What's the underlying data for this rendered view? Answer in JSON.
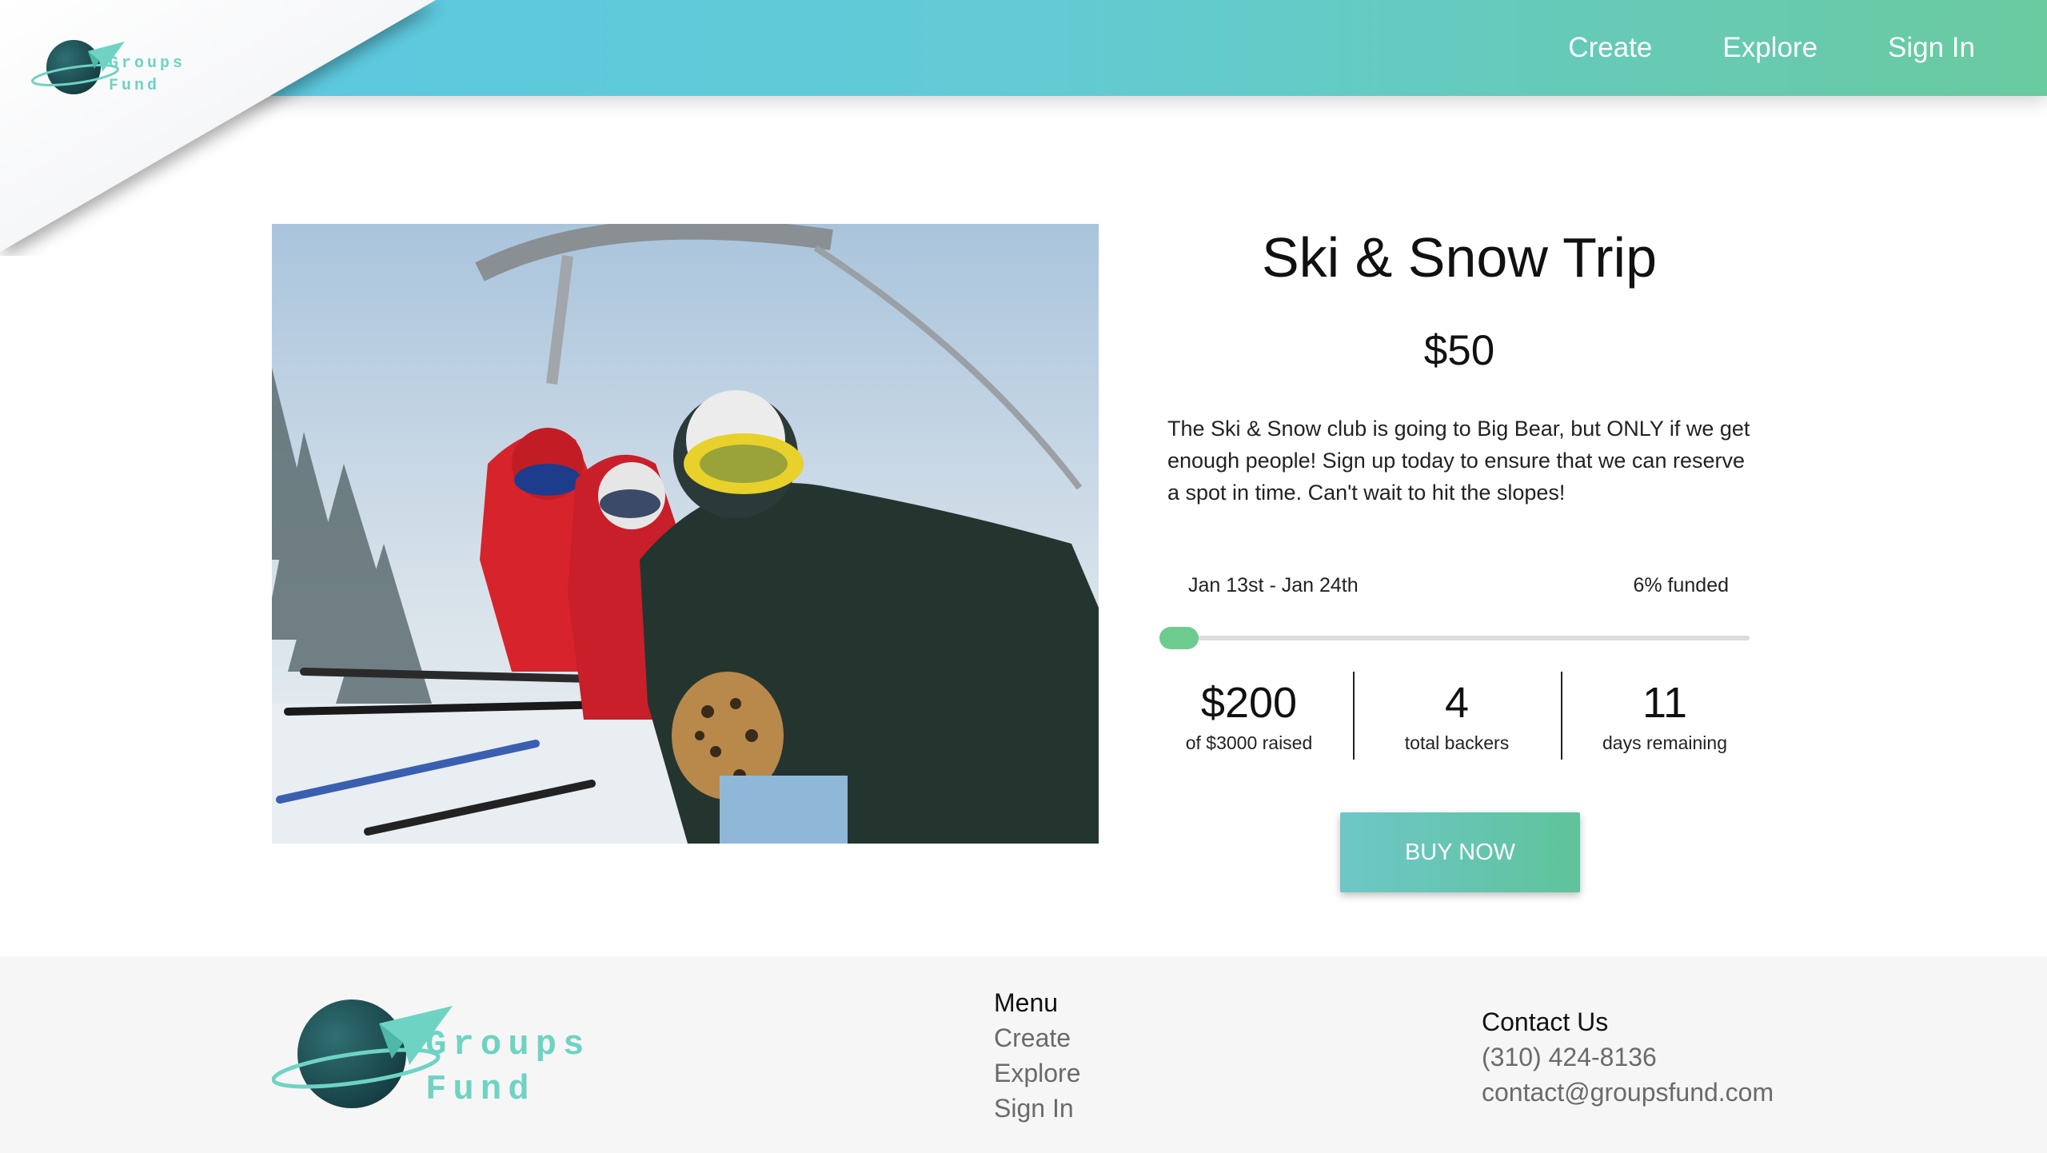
{
  "brand": {
    "line1": "Groups",
    "line2": "Fund"
  },
  "nav": {
    "create": "Create",
    "explore": "Explore",
    "sign_in": "Sign In"
  },
  "campaign": {
    "title": "Ski & Snow Trip",
    "price": "$50",
    "description": "The Ski & Snow club is going to Big Bear, but ONLY if we get enough people! Sign up today to ensure that we can reserve a spot in time. Can't wait to hit the slopes!",
    "dates": "Jan 13st - Jan 24th",
    "funded_text": "6% funded",
    "funded_fraction": 0.067,
    "raised": "$200",
    "raised_label": "of $3000 raised",
    "backers": "4",
    "backers_label": "total backers",
    "days": "11",
    "days_label": "days remaining",
    "buy_label": "BUY NOW"
  },
  "footer": {
    "menu_title": "Menu",
    "menu": [
      "Create",
      "Explore",
      "Sign In"
    ],
    "contact_title": "Contact Us",
    "phone": "(310) 424-8136",
    "email": "contact@groupsfund.com"
  },
  "colors": {
    "header_start": "#5bc7e3",
    "header_end": "#6acaa0",
    "progress": "#6ecb8f",
    "logo_text": "#6fd3c3",
    "planet": "#1f4d52"
  },
  "icons": {
    "logo": "planet-paper-plane-icon"
  }
}
